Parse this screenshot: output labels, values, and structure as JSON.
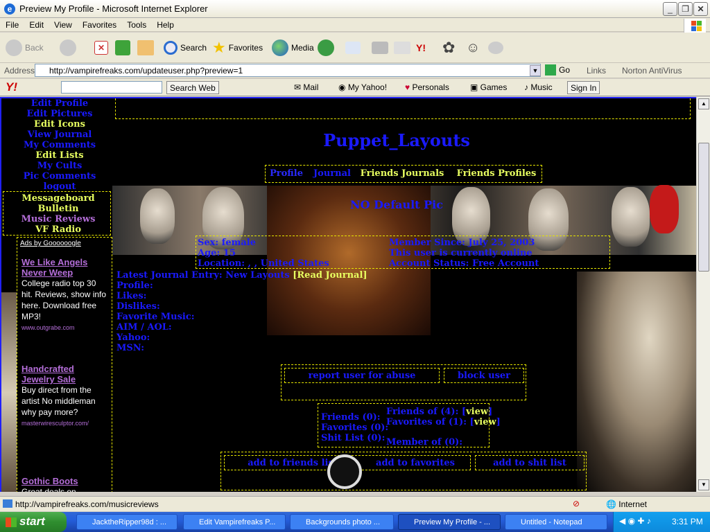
{
  "window": {
    "title": "Preview My Profile - Microsoft Internet Explorer"
  },
  "menu": [
    "File",
    "Edit",
    "View",
    "Favorites",
    "Tools",
    "Help"
  ],
  "toolbar": {
    "back": "Back",
    "search": "Search",
    "favorites": "Favorites",
    "media": "Media"
  },
  "address": {
    "label": "Address",
    "url": "http://vampirefreaks.com/updateuser.php?preview=1",
    "go": "Go",
    "links": "Links",
    "norton": "Norton AntiVirus"
  },
  "yahoo": {
    "logo": "Y!",
    "search": "Search Web",
    "mail": "Mail",
    "myyahoo": "My Yahoo!",
    "personals": "Personals",
    "games": "Games",
    "music": "Music",
    "signin": "Sign In"
  },
  "sidebar": {
    "items": [
      "Edit Profile",
      "Edit Pictures",
      "Edit Icons",
      "View Journal",
      "My Comments",
      "Edit Lists",
      "My Cults",
      "Pic Comments",
      "logout"
    ],
    "items2": [
      "Messageboard",
      "Bulletin",
      "Music Reviews",
      "VF Radio"
    ]
  },
  "ads": {
    "header": "Ads by Goooooogle",
    "list": [
      {
        "title": "We Like Angels Never Weep",
        "body": "College radio top 30 hit. Reviews, show info here. Download free MP3!",
        "url": "www.outgrabe.com"
      },
      {
        "title": "Handcrafted Jewelry Sale",
        "body": "Buy direct from the artist No middleman why pay more?",
        "url": "masterwiresculptor.com/"
      },
      {
        "title": "Gothic Boots",
        "body": "Great deals on"
      }
    ]
  },
  "profile": {
    "name": "Puppet_Layouts",
    "tabs": [
      "Profile",
      "Journal",
      "Friends Journals",
      "Friends Profiles"
    ],
    "nopic": "NO Default Pic",
    "sex": "Sex: female",
    "age": "Age: 15",
    "location": "Location: , , United States",
    "member_since": "Member Since: July 25, 2003",
    "online": "This user is currently online",
    "account": "Account Status: Free Account",
    "journal_prefix": "Latest Journal Entry: New Layouts",
    "journal_link": "[Read Journal]",
    "fields": [
      "Profile:",
      "Likes:",
      "Dislikes:",
      "Favorite Music:",
      "AIM / AOL:",
      "Yahoo:",
      "MSN:"
    ],
    "report": "report user for abuse",
    "block": "block user",
    "friends": "Friends (0):",
    "favorites": "Favorites (0):",
    "shitlist": "Shit List (0):",
    "friends_of": "Friends of (4):",
    "favorites_of": "Favorites of (1):",
    "view": "view",
    "member_of": "Member of (0):",
    "add_friends": "add to friends list",
    "add_favorites": "add to favorites",
    "add_shit": "add to shit list"
  },
  "status": {
    "url": "http://vampirefreaks.com/musicreviews",
    "zone": "Internet"
  },
  "taskbar": {
    "start": "start",
    "tasks": [
      "JacktheRipper98d : ...",
      "Edit Vampirefreaks P...",
      "Backgrounds photo ...",
      "Preview My Profile - ...",
      "Untitled - Notepad"
    ],
    "clock": "3:31 PM"
  }
}
